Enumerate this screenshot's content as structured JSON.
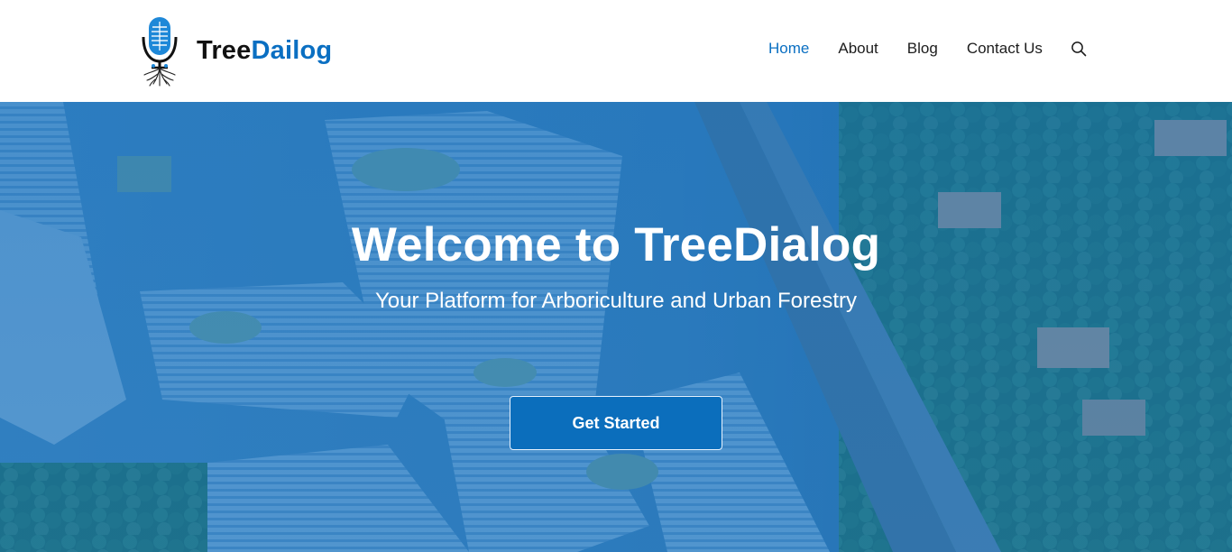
{
  "brand": {
    "name_part1": "Tree",
    "name_part2": "Dailog",
    "logo_icon": "microphone-tree-roots-icon",
    "accent_color": "#0a6fc2"
  },
  "nav": {
    "items": [
      {
        "label": "Home",
        "active": true
      },
      {
        "label": "About",
        "active": false
      },
      {
        "label": "Blog",
        "active": false
      },
      {
        "label": "Contact Us",
        "active": false
      }
    ],
    "search_icon": "search-icon"
  },
  "hero": {
    "title": "Welcome to TreeDialog",
    "subtitle": "Your Platform for Arboriculture and Urban Forestry",
    "cta_label": "Get Started",
    "overlay_color": "#0c68ba",
    "background": "aerial-city-and-trees-image"
  }
}
